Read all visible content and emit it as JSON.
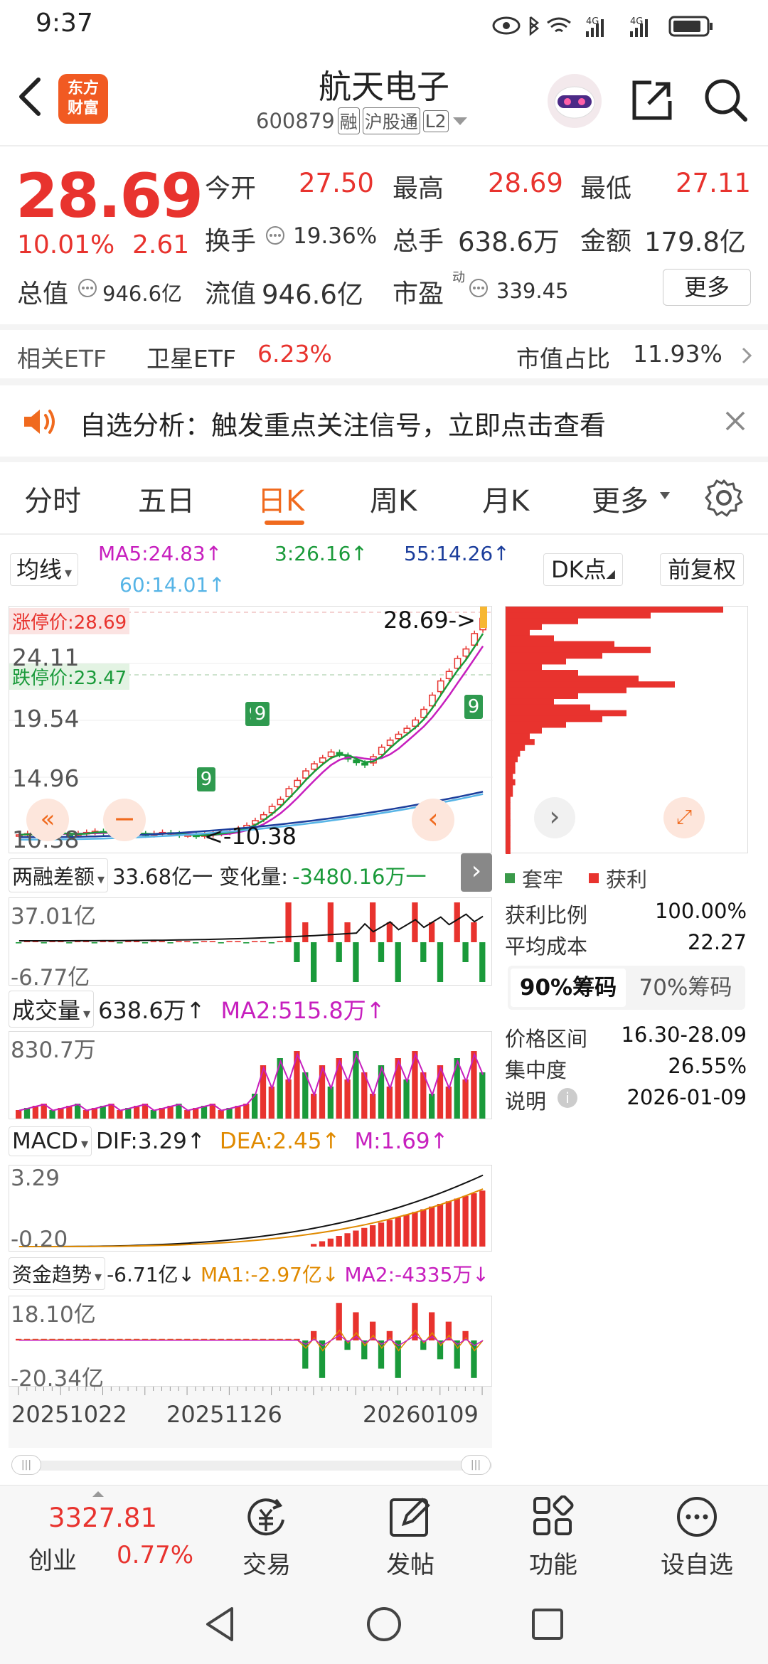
{
  "status_bar": {
    "time": "9:37",
    "net1": "4G",
    "net2": "4G"
  },
  "header": {
    "logo_line1": "东方",
    "logo_line2": "财富",
    "title": "航天电子",
    "code": "600879",
    "tags": [
      "融",
      "沪股通",
      "L2"
    ]
  },
  "quote": {
    "price": "28.69",
    "change_pct": "10.01%",
    "change_abs": "2.61",
    "stats": [
      {
        "label": "今开",
        "value": "27.50"
      },
      {
        "label": "最高",
        "value": "28.69"
      },
      {
        "label": "最低",
        "value": "27.11"
      },
      {
        "label": "换手",
        "value": "19.36%"
      },
      {
        "label": "总手",
        "value": "638.6万"
      },
      {
        "label": "金额",
        "value": "179.8亿"
      },
      {
        "label": "总值",
        "value": "946.6亿"
      },
      {
        "label": "流值",
        "value": "946.6亿"
      },
      {
        "label": "市盈",
        "value": "339.45"
      }
    ],
    "pe_sup": "动",
    "more_button": "更多"
  },
  "etf": {
    "label": "相关ETF",
    "name": "卫星ETF",
    "change": "6.23%",
    "ratio_label": "市值占比",
    "ratio": "11.93%"
  },
  "notice": {
    "text": "自选分析：触发重点关注信号，立即点击查看"
  },
  "tabs": [
    "分时",
    "五日",
    "日K",
    "周K",
    "月K",
    "更多"
  ],
  "active_tab": "日K",
  "chart_toolbar": {
    "indicator": "均线",
    "ma5": "MA5:24.83↑",
    "ma3": "3:26.16↑",
    "ma55": "55:14.26↑",
    "ma60": "60:14.01↑",
    "dk_button": "DK点",
    "adjust_button": "前复权"
  },
  "kline": {
    "limit_up": "涨停价:28.69",
    "limit_down": "跌停价:23.47",
    "top_value": "28.69",
    "y_labels": [
      "24.11",
      "19.54",
      "14.96",
      "10.38"
    ],
    "last_price_tag": "28.69->",
    "low_tag": "<-10.38",
    "signal_badge_1": "9",
    "signal_badge_2": "9",
    "signal_badge_3": "9",
    "signal_badge_4": "9"
  },
  "chip": {
    "legend_trapped": "套牢",
    "legend_profit": "获利",
    "rows": [
      {
        "label": "获利比例",
        "value": "100.00%"
      },
      {
        "label": "平均成本",
        "value": "22.27"
      }
    ],
    "tab_90": "90%筹码",
    "tab_70": "70%筹码",
    "rows2": [
      {
        "label": "价格区间",
        "value": "16.30-28.09"
      },
      {
        "label": "集中度",
        "value": "26.55%"
      },
      {
        "label": "说明",
        "value": "2026-01-09"
      }
    ]
  },
  "margin": {
    "title": "两融差额",
    "value": "33.68亿一 变化量:",
    "change": "-3480.16万一",
    "y_top": "37.01亿",
    "y_bottom": "-6.77亿"
  },
  "volume": {
    "title": "成交量",
    "value": "638.6万↑",
    "ma2": "MA2:515.8万↑",
    "y_top": "830.7万"
  },
  "macd": {
    "title": "MACD",
    "dif": "DIF:3.29↑",
    "dea": "DEA:2.45↑",
    "m": "M:1.69↑",
    "y_top": "3.29",
    "y_bottom": "-0.20"
  },
  "fund": {
    "title": "资金趋势",
    "value": "-6.71亿↓",
    "ma1": "MA1:-2.97亿↓",
    "ma2": "MA2:-4335万↓",
    "y_top": "18.10亿",
    "y_bottom": "-20.34亿"
  },
  "dates": [
    "20251022",
    "20251126",
    "20260109"
  ],
  "bottom_nav": {
    "index_value": "3327.81",
    "index_name": "创业",
    "index_change": "0.77%",
    "items": [
      "交易",
      "发帖",
      "功能",
      "设自选"
    ]
  },
  "colors": {
    "up": "#e8332e",
    "down": "#1a9a3a",
    "accent": "#f06a1e",
    "brand": "#f15a22"
  },
  "chart_data": [
    {
      "type": "line",
      "title": "日K",
      "series": [
        {
          "name": "MA5",
          "last": 24.83
        },
        {
          "name": "MA3",
          "last": 26.16
        },
        {
          "name": "MA55",
          "last": 14.26
        },
        {
          "name": "MA60",
          "last": 14.01
        }
      ],
      "y_ticks": [
        24.11,
        19.54,
        14.96,
        10.38
      ],
      "close_approx": [
        10.4,
        10.5,
        10.4,
        10.5,
        10.6,
        10.5,
        10.4,
        10.5,
        10.6,
        10.7,
        10.6,
        10.5,
        10.4,
        10.6,
        10.5,
        10.4,
        10.5,
        10.6,
        10.5,
        10.4,
        10.4,
        10.3,
        10.4,
        10.5,
        10.6,
        10.7,
        10.9,
        11.2,
        11.6,
        12.1,
        12.8,
        13.4,
        14.3,
        15.0,
        15.8,
        16.4,
        16.9,
        17.4,
        17.2,
        16.8,
        16.5,
        16.3,
        17.0,
        17.8,
        18.4,
        18.9,
        19.4,
        20.1,
        21.0,
        22.2,
        23.4,
        24.2,
        25.3,
        26.1,
        27.4,
        28.69
      ]
    }
  ]
}
